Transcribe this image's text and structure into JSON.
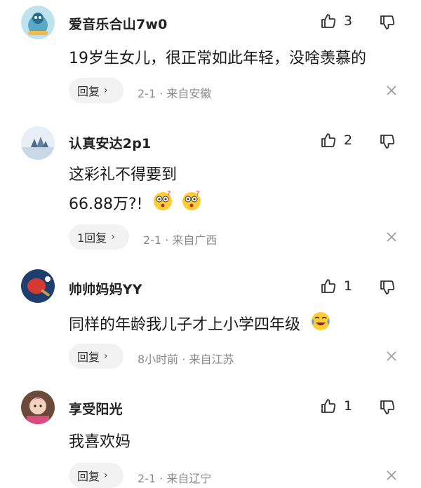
{
  "comments": [
    {
      "username": "爱音乐合山7w0",
      "likes": "3",
      "text_lines": [
        "19岁生女儿，很正常如此年轻，没啥羡慕的"
      ],
      "reply_label": "回复",
      "meta": "2-1 · 来自安徽"
    },
    {
      "username": "认真安达2p1",
      "likes": "2",
      "text_lines": [
        "这彩礼不得要到",
        "66.88万?!"
      ],
      "reply_label": "1回复",
      "meta": "2-1 · 来自广西"
    },
    {
      "username": "帅帅妈妈YY",
      "likes": "1",
      "text_lines": [
        "同样的年龄我儿子才上小学四年级"
      ],
      "reply_label": "回复",
      "meta": "8小时前 · 来自江苏"
    },
    {
      "username": "享受阳光",
      "likes": "1",
      "text_lines": [
        "我喜欢妈"
      ],
      "reply_label": "回复",
      "meta": "2-1 · 来自辽宁"
    }
  ],
  "icons": {
    "like": "thumbs-up-icon",
    "dislike": "thumbs-down-icon",
    "close": "close-icon",
    "chevron": "chevron-right-icon"
  },
  "colors": {
    "meta_text": "#8a8a8a",
    "reply_bg": "#f2f2f2",
    "icon": "#333333"
  }
}
